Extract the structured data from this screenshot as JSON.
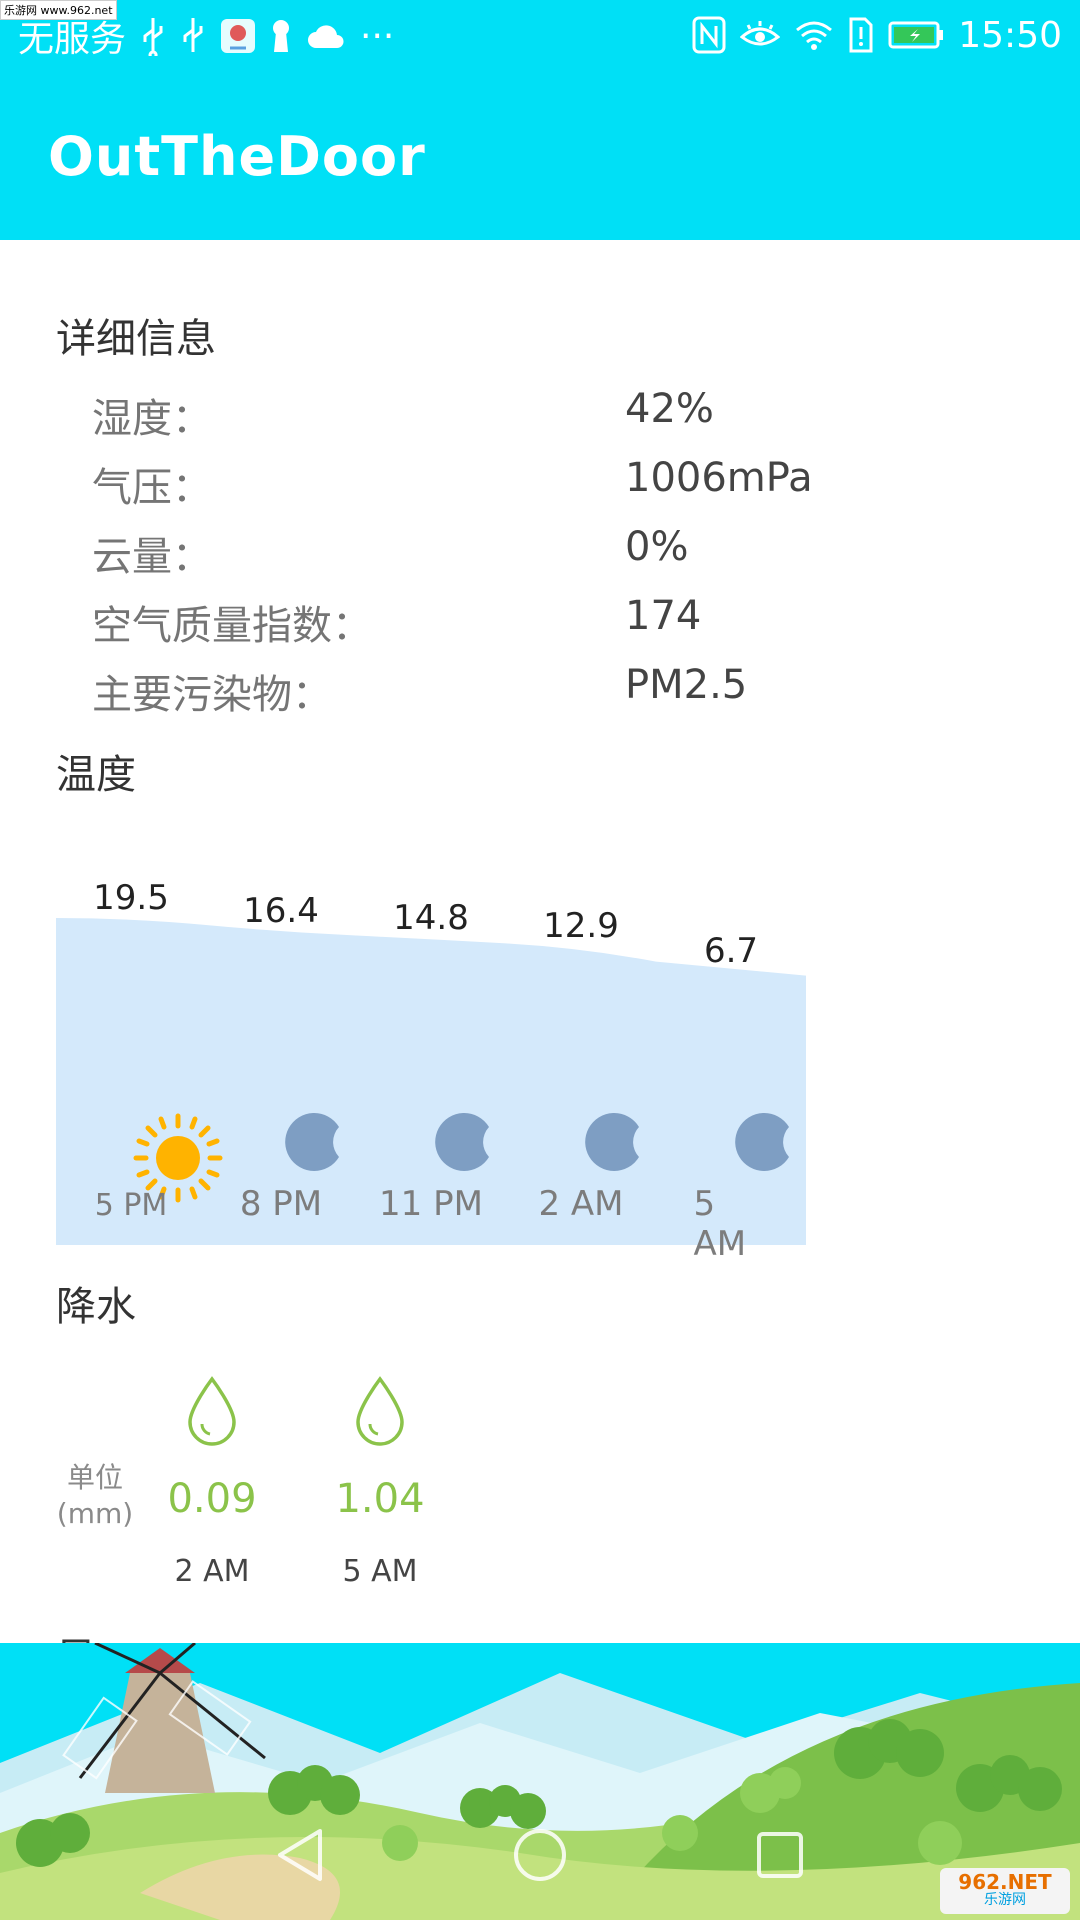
{
  "status_bar": {
    "carrier": "无服务",
    "time": "15:50",
    "watermark": "乐游网 www.962.net",
    "more": "···"
  },
  "app": {
    "title": "OutTheDoor"
  },
  "details": {
    "heading": "详细信息",
    "rows": [
      {
        "label": "湿度：",
        "value": "42%"
      },
      {
        "label": "气压：",
        "value": "1006mPa"
      },
      {
        "label": "云量：",
        "value": "0%"
      },
      {
        "label": "空气质量指数：",
        "value": "174"
      },
      {
        "label": "主要污染物：",
        "value": "PM2.5"
      }
    ]
  },
  "temperature": {
    "heading": "温度",
    "points": [
      {
        "value": "19.5",
        "time": "5 PM",
        "icon": "sun-icon"
      },
      {
        "value": "16.4",
        "time": "8 PM",
        "icon": "moon-icon"
      },
      {
        "value": "14.8",
        "time": "11 PM",
        "icon": "moon-icon"
      },
      {
        "value": "12.9",
        "time": "2 AM",
        "icon": "moon-icon"
      },
      {
        "value": "6.7",
        "time": "5 AM",
        "icon": "moon-icon"
      }
    ],
    "colors": {
      "fill": "#D4E9FB",
      "sun": "#FFB300",
      "moon": "#7E9EC3"
    }
  },
  "precipitation": {
    "heading": "降水",
    "unit_label": "单位",
    "unit": "(mm)",
    "items": [
      {
        "value": "0.09",
        "time": "2 AM"
      },
      {
        "value": "1.04",
        "time": "5 AM"
      }
    ],
    "color": "#8BC34A"
  },
  "wind": {
    "heading_partial": "风"
  },
  "branding": {
    "badge_main": "962.NET",
    "badge_sub": "乐游网"
  },
  "colors": {
    "accent": "#00E0F6"
  }
}
